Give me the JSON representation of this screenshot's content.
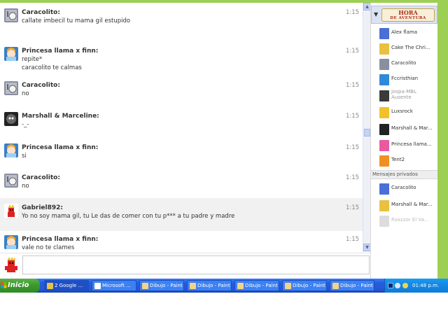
{
  "messages": [
    {
      "user": "Caracolito:",
      "lines": [
        "callate imbecil tu mama gil estupido"
      ],
      "time": "1:15",
      "avatar_icon": "snail-avatar-icon",
      "highlight": false
    },
    {
      "user": "Princesa llama x finn:",
      "lines": [
        "repite*",
        "caracolito te calmas"
      ],
      "time": "1:15",
      "avatar_icon": "princess-avatar-icon",
      "highlight": false
    },
    {
      "user": "Caracolito:",
      "lines": [
        "no"
      ],
      "time": "1:15",
      "avatar_icon": "snail-avatar-icon",
      "highlight": false
    },
    {
      "user": "Marshall & Marceline:",
      "lines": [
        "-_-"
      ],
      "time": "1:15",
      "avatar_icon": "marshall-avatar-icon",
      "highlight": false
    },
    {
      "user": "Princesa llama x finn:",
      "lines": [
        "si"
      ],
      "time": "1:15",
      "avatar_icon": "princess-avatar-icon",
      "highlight": false
    },
    {
      "user": "Caracolito:",
      "lines": [
        "no"
      ],
      "time": "1:15",
      "avatar_icon": "snail-avatar-icon",
      "highlight": false
    },
    {
      "user": "Gabriel892:",
      "lines": [
        "Yo no soy mama gil, tu Le das de comer con tu p*** a tu padre y madre"
      ],
      "time": "1:15",
      "avatar_icon": "gabriel-avatar-icon",
      "highlight": true
    },
    {
      "user": "Princesa llama x finn:",
      "lines": [
        "vale no te clames"
      ],
      "time": "1:15",
      "avatar_icon": "princess-avatar-icon",
      "highlight": false
    }
  ],
  "rail": {
    "logo_text": "HORA",
    "logo_subtext": "DE AVENTURA",
    "users": [
      {
        "name": "Alex flama",
        "style": "normal"
      },
      {
        "name": "Cake The Chri...",
        "style": "normal"
      },
      {
        "name": "Caracolito",
        "style": "normal"
      },
      {
        "name": "Fccristhian",
        "style": "normal"
      },
      {
        "name": "Jospa-MBL Ausente",
        "style": "two"
      },
      {
        "name": "Luxsrock",
        "style": "normal"
      },
      {
        "name": "Marshall & Mar...",
        "style": "normal"
      },
      {
        "name": "Princesa llama...",
        "style": "normal"
      },
      {
        "name": "Tent2",
        "style": "normal"
      }
    ],
    "private_section": "Mensajes privados",
    "private_users": [
      {
        "name": "Caracolito",
        "style": "normal"
      },
      {
        "name": "Marshall & Mar...",
        "style": "normal"
      },
      {
        "name": "Raxzzor El Va...",
        "style": "faded"
      }
    ]
  },
  "composer": {
    "placeholder": ""
  },
  "taskbar": {
    "start_label": "Inicio",
    "tasks": [
      {
        "label": "2 Google ...",
        "icon": "chrome-icon",
        "active": true
      },
      {
        "label": "Microsoft ...",
        "icon": "word-icon",
        "active": false
      },
      {
        "label": "Dibujo - Paint",
        "icon": "paint-icon",
        "active": false
      },
      {
        "label": "Dibujo - Paint",
        "icon": "paint-icon",
        "active": false
      },
      {
        "label": "Dibujo - Paint",
        "icon": "paint-icon",
        "active": false
      },
      {
        "label": "Dibujo - Paint",
        "icon": "paint-icon",
        "active": false
      },
      {
        "label": "Dibujo - Paint",
        "icon": "paint-icon",
        "active": false
      }
    ],
    "clock": "01:48 p.m."
  },
  "colors": {
    "frame_green": "#9ecf55",
    "taskbar_blue": "#245edb",
    "start_green": "#3b9a2d",
    "highlight_row": "#f1f1f1"
  }
}
